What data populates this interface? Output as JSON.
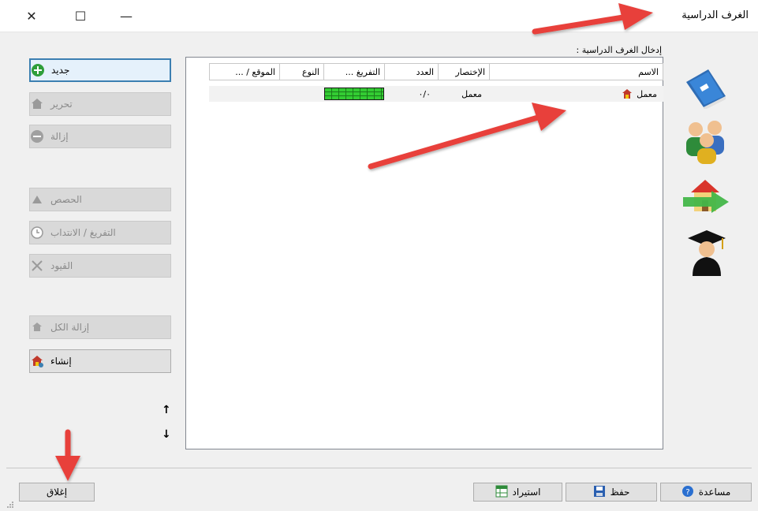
{
  "window": {
    "title": "الغرف الدراسية",
    "close_glyph": "✕",
    "maximize_glyph": "☐",
    "minimize_glyph": "—"
  },
  "section_label": "إدخال الغرف الدراسية :",
  "left_buttons": {
    "new": "جديد",
    "edit": "تحرير",
    "remove": "إزالة",
    "lessons": "الحصص",
    "availability": "التفريغ / الانتداب",
    "constraints": "القيود",
    "remove_all": "إزالة الكل",
    "create": "إنشاء"
  },
  "move_up_glyph": "↑",
  "move_down_glyph": "↓",
  "table": {
    "columns": [
      "الاسم",
      "الإختصار",
      "العدد",
      "التفريغ ...",
      "النوع",
      "الموقع / ..."
    ],
    "rows": [
      {
        "name": "معمل",
        "abbr": "معمل",
        "count": "٠/٠",
        "availability": "",
        "type": "",
        "location": ""
      }
    ]
  },
  "bottom_buttons": {
    "help": "مساعدة",
    "save": "حفظ",
    "import": "استيراد",
    "close": "إغلاق"
  },
  "colors": {
    "annotation_arrow": "#e8413a",
    "availability_bar": "#33cc33",
    "primary_border": "#3c7fb1"
  },
  "icons": [
    "plus-circle-icon",
    "house-icon",
    "minus-circle-icon",
    "lesson-icon",
    "clock-icon",
    "constraints-icon",
    "remove-all-icon",
    "create-icon",
    "book-icon",
    "people-icon",
    "building-arrow-icon",
    "graduate-icon",
    "help-icon",
    "save-icon",
    "import-icon"
  ]
}
